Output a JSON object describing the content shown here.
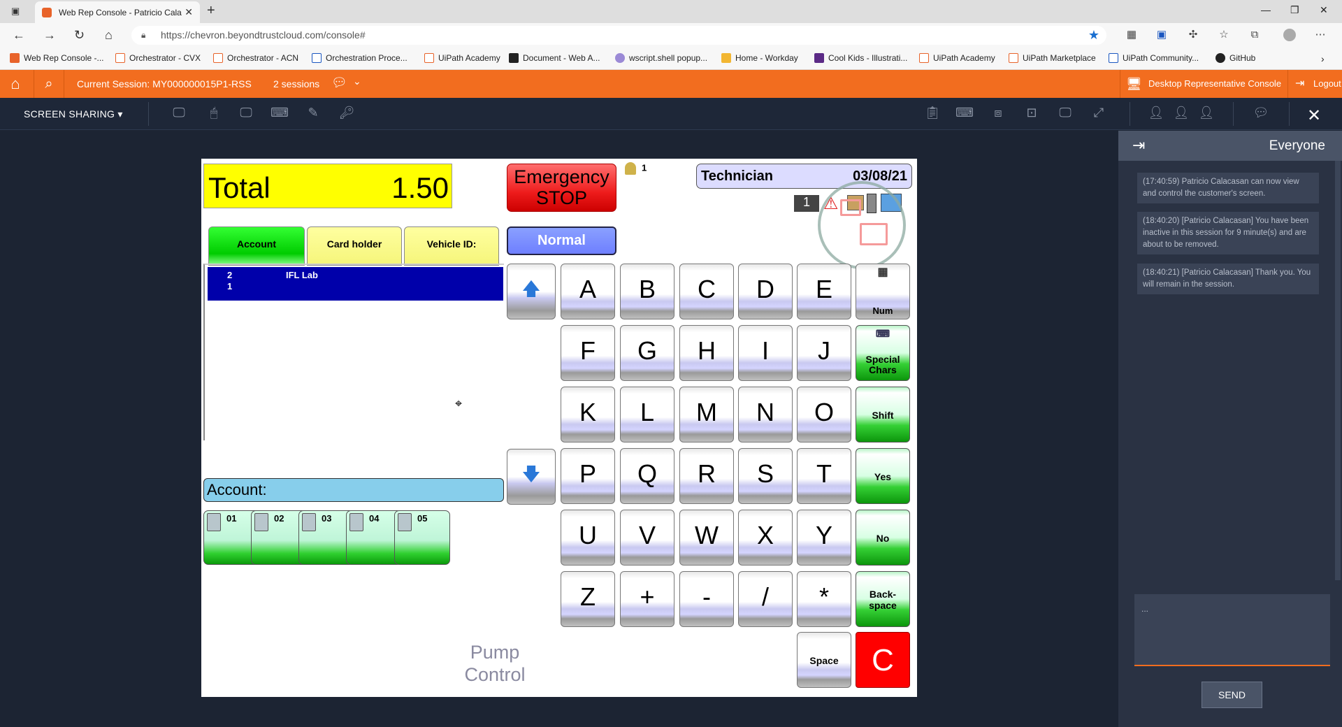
{
  "browser": {
    "tab_title": "Web Rep Console - Patricio Cala",
    "url": "https://chevron.beyondtrustcloud.com/console#",
    "bookmarks": [
      "Web Rep Console -...",
      "Orchestrator - CVX",
      "Orchestrator - ACN",
      "Orchestration Proce...",
      "UiPath Academy",
      "Document - Web A...",
      "wscript.shell popup...",
      "Home - Workday",
      "Cool Kids - Illustrati...",
      "UiPath Academy",
      "UiPath Marketplace",
      "UiPath Community...",
      "GitHub"
    ]
  },
  "console": {
    "current_session": "Current Session: MY000000015P1-RSS",
    "sessions": "2 sessions",
    "desktop_rep_console": "Desktop Representative Console",
    "logout": "Logout",
    "screen_sharing": "SCREEN SHARING"
  },
  "remote": {
    "total_label": "Total",
    "total_value": "1.50",
    "emergency_line1": "Emergency",
    "emergency_line2": "STOP",
    "operator_count": "1",
    "tech_label": "Technician",
    "tech_date": "03/08/21",
    "status_num": "1",
    "tabs": [
      "Account",
      "Card holder",
      "Vehicle ID:"
    ],
    "mode": "Normal",
    "selected_row": {
      "c1a": "2",
      "c1b": "1",
      "c2": "IFL Lab"
    },
    "account_field": "Account:",
    "pumps": [
      "01",
      "02",
      "03",
      "04",
      "05"
    ],
    "pump_control_1": "Pump",
    "pump_control_2": "Control",
    "keys": [
      [
        "A",
        "B",
        "C",
        "D",
        "E"
      ],
      [
        "F",
        "G",
        "H",
        "I",
        "J"
      ],
      [
        "K",
        "L",
        "M",
        "N",
        "O"
      ],
      [
        "P",
        "Q",
        "R",
        "S",
        "T"
      ],
      [
        "U",
        "V",
        "W",
        "X",
        "Y"
      ],
      [
        "Z",
        "+",
        "-",
        "/",
        "*"
      ]
    ],
    "side_keys": {
      "num": "Num",
      "special_1": "Special",
      "special_2": "Chars",
      "shift": "Shift",
      "yes": "Yes",
      "no": "No",
      "back_1": "Back-",
      "back_2": "space",
      "space": "Space",
      "clear": "C"
    }
  },
  "chat": {
    "title": "Everyone",
    "messages": [
      "(17:40:59) Patricio Calacasan can now view and control the customer's screen.",
      "(18:40:20) [Patricio Calacasan] You have been inactive in this session for 9 minute(s) and are about to be removed.",
      "(18:40:21) [Patricio Calacasan] Thank you. You will remain in the session."
    ],
    "input_value": "...",
    "send": "SEND"
  },
  "colors": {
    "accent": "#f26d1f",
    "console_bg": "#1c2433"
  }
}
